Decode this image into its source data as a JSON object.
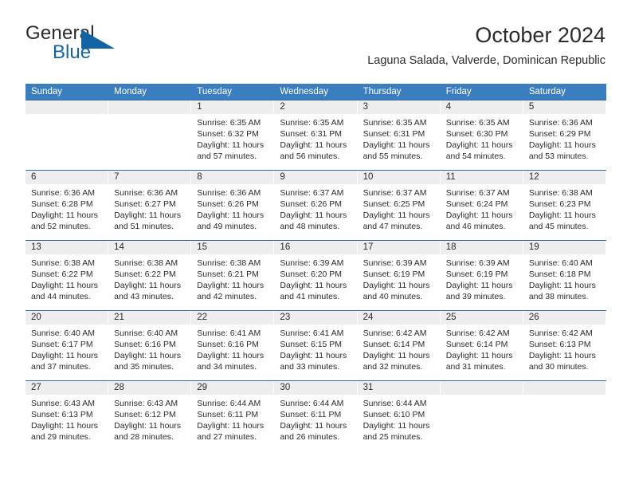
{
  "brand": {
    "name_part1": "General",
    "name_part2": "Blue",
    "logo_icon": "blue-triangle-icon",
    "color_dark": "#2b2b2b",
    "color_blue": "#1464a5"
  },
  "header": {
    "title": "October 2024",
    "subtitle": "Laguna Salada, Valverde, Dominican Republic"
  },
  "theme": {
    "header_bg": "#3b7ebf",
    "header_text": "#ffffff",
    "row_divider": "#2f6ba6",
    "daynum_band": "#eeeeee",
    "cell_bg": "#ffffff",
    "text": "#2b2b2b"
  },
  "calendar": {
    "weekday_headers": [
      "Sunday",
      "Monday",
      "Tuesday",
      "Wednesday",
      "Thursday",
      "Friday",
      "Saturday"
    ],
    "weeks": [
      [
        {
          "day": "",
          "empty": true
        },
        {
          "day": "",
          "empty": true
        },
        {
          "day": "1",
          "sunrise": "Sunrise: 6:35 AM",
          "sunset": "Sunset: 6:32 PM",
          "daylight1": "Daylight: 11 hours",
          "daylight2": "and 57 minutes."
        },
        {
          "day": "2",
          "sunrise": "Sunrise: 6:35 AM",
          "sunset": "Sunset: 6:31 PM",
          "daylight1": "Daylight: 11 hours",
          "daylight2": "and 56 minutes."
        },
        {
          "day": "3",
          "sunrise": "Sunrise: 6:35 AM",
          "sunset": "Sunset: 6:31 PM",
          "daylight1": "Daylight: 11 hours",
          "daylight2": "and 55 minutes."
        },
        {
          "day": "4",
          "sunrise": "Sunrise: 6:35 AM",
          "sunset": "Sunset: 6:30 PM",
          "daylight1": "Daylight: 11 hours",
          "daylight2": "and 54 minutes."
        },
        {
          "day": "5",
          "sunrise": "Sunrise: 6:36 AM",
          "sunset": "Sunset: 6:29 PM",
          "daylight1": "Daylight: 11 hours",
          "daylight2": "and 53 minutes."
        }
      ],
      [
        {
          "day": "6",
          "sunrise": "Sunrise: 6:36 AM",
          "sunset": "Sunset: 6:28 PM",
          "daylight1": "Daylight: 11 hours",
          "daylight2": "and 52 minutes."
        },
        {
          "day": "7",
          "sunrise": "Sunrise: 6:36 AM",
          "sunset": "Sunset: 6:27 PM",
          "daylight1": "Daylight: 11 hours",
          "daylight2": "and 51 minutes."
        },
        {
          "day": "8",
          "sunrise": "Sunrise: 6:36 AM",
          "sunset": "Sunset: 6:26 PM",
          "daylight1": "Daylight: 11 hours",
          "daylight2": "and 49 minutes."
        },
        {
          "day": "9",
          "sunrise": "Sunrise: 6:37 AM",
          "sunset": "Sunset: 6:26 PM",
          "daylight1": "Daylight: 11 hours",
          "daylight2": "and 48 minutes."
        },
        {
          "day": "10",
          "sunrise": "Sunrise: 6:37 AM",
          "sunset": "Sunset: 6:25 PM",
          "daylight1": "Daylight: 11 hours",
          "daylight2": "and 47 minutes."
        },
        {
          "day": "11",
          "sunrise": "Sunrise: 6:37 AM",
          "sunset": "Sunset: 6:24 PM",
          "daylight1": "Daylight: 11 hours",
          "daylight2": "and 46 minutes."
        },
        {
          "day": "12",
          "sunrise": "Sunrise: 6:38 AM",
          "sunset": "Sunset: 6:23 PM",
          "daylight1": "Daylight: 11 hours",
          "daylight2": "and 45 minutes."
        }
      ],
      [
        {
          "day": "13",
          "sunrise": "Sunrise: 6:38 AM",
          "sunset": "Sunset: 6:22 PM",
          "daylight1": "Daylight: 11 hours",
          "daylight2": "and 44 minutes."
        },
        {
          "day": "14",
          "sunrise": "Sunrise: 6:38 AM",
          "sunset": "Sunset: 6:22 PM",
          "daylight1": "Daylight: 11 hours",
          "daylight2": "and 43 minutes."
        },
        {
          "day": "15",
          "sunrise": "Sunrise: 6:38 AM",
          "sunset": "Sunset: 6:21 PM",
          "daylight1": "Daylight: 11 hours",
          "daylight2": "and 42 minutes."
        },
        {
          "day": "16",
          "sunrise": "Sunrise: 6:39 AM",
          "sunset": "Sunset: 6:20 PM",
          "daylight1": "Daylight: 11 hours",
          "daylight2": "and 41 minutes."
        },
        {
          "day": "17",
          "sunrise": "Sunrise: 6:39 AM",
          "sunset": "Sunset: 6:19 PM",
          "daylight1": "Daylight: 11 hours",
          "daylight2": "and 40 minutes."
        },
        {
          "day": "18",
          "sunrise": "Sunrise: 6:39 AM",
          "sunset": "Sunset: 6:19 PM",
          "daylight1": "Daylight: 11 hours",
          "daylight2": "and 39 minutes."
        },
        {
          "day": "19",
          "sunrise": "Sunrise: 6:40 AM",
          "sunset": "Sunset: 6:18 PM",
          "daylight1": "Daylight: 11 hours",
          "daylight2": "and 38 minutes."
        }
      ],
      [
        {
          "day": "20",
          "sunrise": "Sunrise: 6:40 AM",
          "sunset": "Sunset: 6:17 PM",
          "daylight1": "Daylight: 11 hours",
          "daylight2": "and 37 minutes."
        },
        {
          "day": "21",
          "sunrise": "Sunrise: 6:40 AM",
          "sunset": "Sunset: 6:16 PM",
          "daylight1": "Daylight: 11 hours",
          "daylight2": "and 35 minutes."
        },
        {
          "day": "22",
          "sunrise": "Sunrise: 6:41 AM",
          "sunset": "Sunset: 6:16 PM",
          "daylight1": "Daylight: 11 hours",
          "daylight2": "and 34 minutes."
        },
        {
          "day": "23",
          "sunrise": "Sunrise: 6:41 AM",
          "sunset": "Sunset: 6:15 PM",
          "daylight1": "Daylight: 11 hours",
          "daylight2": "and 33 minutes."
        },
        {
          "day": "24",
          "sunrise": "Sunrise: 6:42 AM",
          "sunset": "Sunset: 6:14 PM",
          "daylight1": "Daylight: 11 hours",
          "daylight2": "and 32 minutes."
        },
        {
          "day": "25",
          "sunrise": "Sunrise: 6:42 AM",
          "sunset": "Sunset: 6:14 PM",
          "daylight1": "Daylight: 11 hours",
          "daylight2": "and 31 minutes."
        },
        {
          "day": "26",
          "sunrise": "Sunrise: 6:42 AM",
          "sunset": "Sunset: 6:13 PM",
          "daylight1": "Daylight: 11 hours",
          "daylight2": "and 30 minutes."
        }
      ],
      [
        {
          "day": "27",
          "sunrise": "Sunrise: 6:43 AM",
          "sunset": "Sunset: 6:13 PM",
          "daylight1": "Daylight: 11 hours",
          "daylight2": "and 29 minutes."
        },
        {
          "day": "28",
          "sunrise": "Sunrise: 6:43 AM",
          "sunset": "Sunset: 6:12 PM",
          "daylight1": "Daylight: 11 hours",
          "daylight2": "and 28 minutes."
        },
        {
          "day": "29",
          "sunrise": "Sunrise: 6:44 AM",
          "sunset": "Sunset: 6:11 PM",
          "daylight1": "Daylight: 11 hours",
          "daylight2": "and 27 minutes."
        },
        {
          "day": "30",
          "sunrise": "Sunrise: 6:44 AM",
          "sunset": "Sunset: 6:11 PM",
          "daylight1": "Daylight: 11 hours",
          "daylight2": "and 26 minutes."
        },
        {
          "day": "31",
          "sunrise": "Sunrise: 6:44 AM",
          "sunset": "Sunset: 6:10 PM",
          "daylight1": "Daylight: 11 hours",
          "daylight2": "and 25 minutes."
        },
        {
          "day": "",
          "empty": true
        },
        {
          "day": "",
          "empty": true
        }
      ]
    ]
  }
}
